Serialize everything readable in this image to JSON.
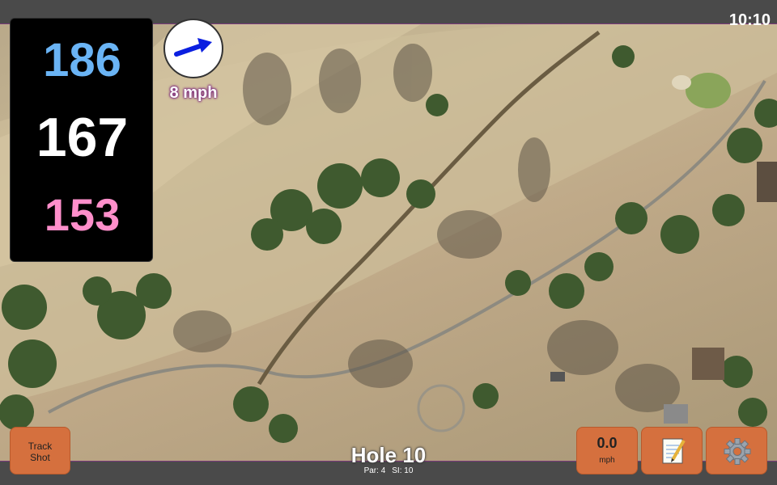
{
  "status": {
    "time": "10:10"
  },
  "distances": {
    "back": "186",
    "center": "167",
    "front": "153"
  },
  "wind": {
    "speed_label": "8 mph",
    "arrow_icon": "arrow-northeast-icon",
    "arrow_color": "#0b1fe0"
  },
  "hole": {
    "title": "Hole 10",
    "par": "Par: 4",
    "stroke_index": "SI: 10"
  },
  "buttons": {
    "track_shot": "Track\nShot",
    "speed_value": "0.0",
    "speed_unit": "mph",
    "notes_icon": "notepad-pencil-icon",
    "settings_icon": "gear-icon"
  },
  "colors": {
    "accent": "#d5703e",
    "back_distance": "#6ab4f5",
    "front_distance": "#ff8fcb",
    "center_distance": "#ffffff"
  }
}
